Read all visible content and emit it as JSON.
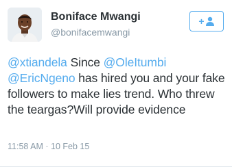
{
  "tweet": {
    "author": {
      "display_name": "Boniface Mwangi",
      "username": "@bonifacemwangi"
    },
    "follow_button": {
      "label": "+",
      "icon": "person-icon"
    },
    "text": {
      "mention_1": "@xtiandela",
      "segment_1": " Since ",
      "mention_2": "@OleItumbi",
      "segment_2": " ",
      "mention_3": "@EricNgeno",
      "segment_3": " has hired you and your fake followers to make lies trend. Who threw the teargas?Will provide evidence"
    },
    "timestamp": "11:58 AM · 10 Feb 15",
    "colors": {
      "link": "#55acee",
      "text": "#292f33",
      "secondary": "#8899a6"
    }
  }
}
